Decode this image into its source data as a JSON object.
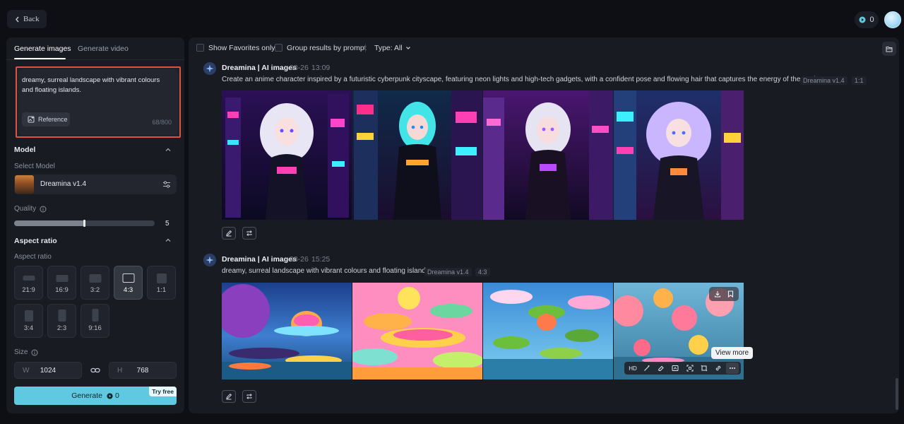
{
  "topbar": {
    "back_label": "Back",
    "credits": "0"
  },
  "left": {
    "tabs": [
      "Generate images",
      "Generate video"
    ],
    "prompt": {
      "text": "dreamy, surreal landscape with vibrant colours and floating islands.",
      "reference_label": "Reference",
      "char_count": "68/800"
    },
    "model": {
      "section_title": "Model",
      "select_label": "Select Model",
      "name": "Dreamina v1.4"
    },
    "quality": {
      "label": "Quality",
      "value": "5",
      "fill_fraction": 0.5
    },
    "aspect": {
      "section_title": "Aspect ratio",
      "sub_label": "Aspect ratio",
      "options": [
        "21:9",
        "16:9",
        "3:2",
        "4:3",
        "1:1",
        "3:4",
        "2:3",
        "9:16"
      ],
      "selected": "4:3"
    },
    "size": {
      "label": "Size",
      "w_key": "W",
      "w_value": "1024",
      "h_key": "H",
      "h_value": "768"
    },
    "generate": {
      "label": "Generate",
      "cost": "0",
      "badge": "Try free"
    }
  },
  "right": {
    "filters": {
      "favorites": "Show Favorites only",
      "group": "Group results by prompt",
      "type": "Type: All"
    },
    "generations": [
      {
        "title": "Dreamina | AI images",
        "date": "08-26",
        "time": "13:09",
        "prompt": "Create an anime character inspired by a futuristic cyberpunk cityscape, featuring neon lights and high-tech gadgets, with a confident pose and flowing hair that captures the energy of the setting.",
        "model_tag": "Dreamina v1.4",
        "ratio_tag": "1:1"
      },
      {
        "title": "Dreamina | AI images",
        "date": "08-26",
        "time": "15:25",
        "prompt": "dreamy, surreal landscape with vibrant colours and floating islands.",
        "model_tag": "Dreamina v1.4",
        "ratio_tag": "4:3"
      }
    ],
    "hover_toolbar": {
      "hd_label": "HD",
      "tooltip": "View more"
    }
  },
  "colors": {
    "accent": "#5ec9e0",
    "highlight_border": "#e0533a",
    "panel": "#181b22",
    "background": "#0d0f14"
  }
}
